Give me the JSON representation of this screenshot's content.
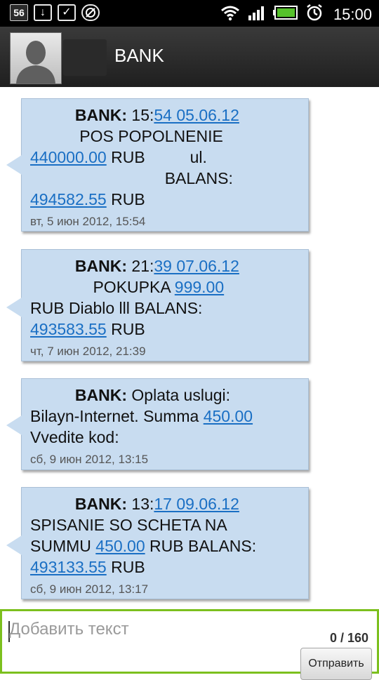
{
  "statusbar": {
    "badge": "56",
    "time": "15:00"
  },
  "header": {
    "title": "BANK"
  },
  "messages": [
    {
      "sender": "BANK:",
      "parts": [
        {
          "t": " 15:"
        },
        {
          "t": "54 05.06.12",
          "link": true
        },
        {
          "t": "\n           POS POPOLNENIE\n"
        },
        {
          "t": "440000.00",
          "link": true
        },
        {
          "t": " RUB          ul.\n                              BALANS:\n"
        },
        {
          "t": "494582.55",
          "link": true
        },
        {
          "t": " RUB"
        }
      ],
      "time": "вт, 5 июн 2012, 15:54"
    },
    {
      "sender": "BANK:",
      "parts": [
        {
          "t": " 21:"
        },
        {
          "t": "39 07.06.12",
          "link": true
        },
        {
          "t": "\n              POKUPKA "
        },
        {
          "t": "999.00",
          "link": true
        },
        {
          "t": "\nRUB Diablo lll BALANS:\n"
        },
        {
          "t": "493583.55",
          "link": true
        },
        {
          "t": " RUB"
        }
      ],
      "time": "чт, 7 июн 2012, 21:39"
    },
    {
      "sender": "BANK:",
      "parts": [
        {
          "t": " Oplata uslugi:\nBilayn-Internet. Summa "
        },
        {
          "t": "450.00",
          "link": true
        },
        {
          "t": "\nVvedite kod:"
        }
      ],
      "time": "сб, 9 июн 2012, 13:15"
    },
    {
      "sender": "BANK:",
      "parts": [
        {
          "t": " 13:"
        },
        {
          "t": "17 09.06.12",
          "link": true
        },
        {
          "t": "\nSPISANIE SO SCHETA NA\nSUMMU "
        },
        {
          "t": "450.00",
          "link": true
        },
        {
          "t": " RUB BALANS:\n"
        },
        {
          "t": "493133.55",
          "link": true
        },
        {
          "t": " RUB"
        }
      ],
      "time": "сб, 9 июн 2012, 13:17"
    }
  ],
  "compose": {
    "placeholder": "Добавить текст",
    "counter": "0 / 160",
    "send_label": "Отправить"
  },
  "colors": {
    "bubble": "#c8dcf0",
    "link": "#1a6fc4",
    "compose_border": "#7cc01e"
  }
}
